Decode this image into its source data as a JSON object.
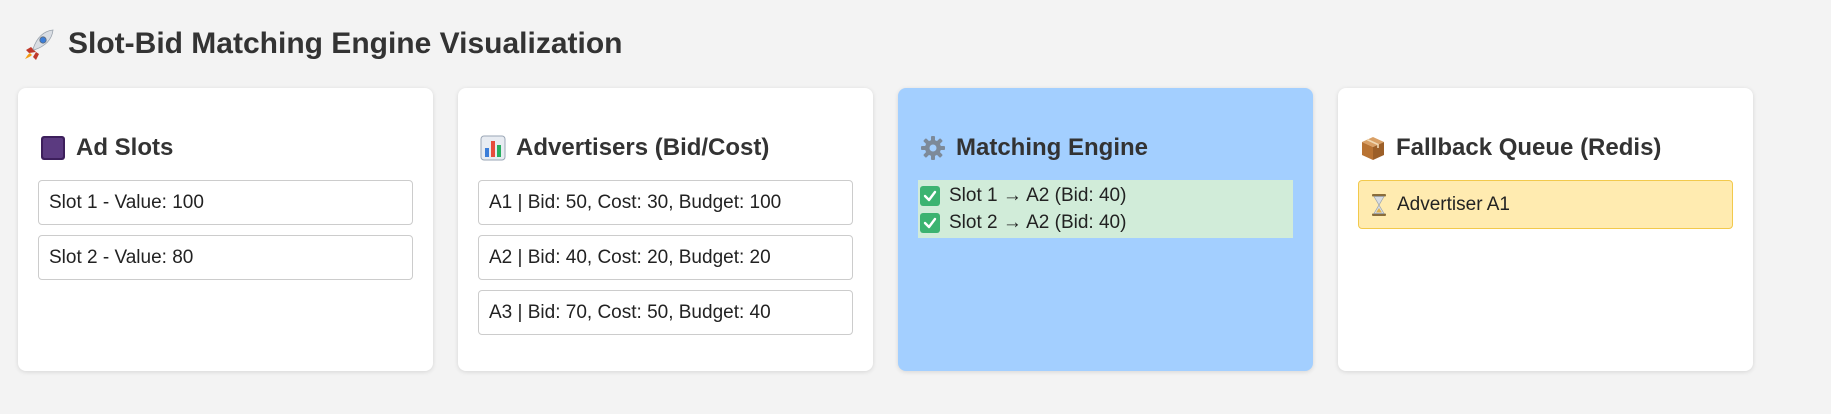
{
  "page": {
    "title": "Slot-Bid Matching Engine Visualization",
    "title_icon": "rocket-icon"
  },
  "ad_slots": {
    "heading": "Ad Slots",
    "icon": "stop-square-icon",
    "items": [
      "Slot 1 - Value: 100",
      "Slot 2 - Value: 80"
    ]
  },
  "advertisers": {
    "heading": "Advertisers (Bid/Cost)",
    "icon": "bar-chart-icon",
    "items": [
      "A1 | Bid: 50, Cost: 30, Budget: 100",
      "A2 | Bid: 40, Cost: 20, Budget: 20",
      "A3 | Bid: 70, Cost: 50, Budget: 40"
    ]
  },
  "matching_engine": {
    "heading": "Matching Engine",
    "icon": "gear-icon",
    "matches": [
      "Slot 1 → A2 (Bid: 40)",
      "Slot 2 → A2 (Bid: 40)"
    ],
    "match_icon": "check-box-icon"
  },
  "fallback_queue": {
    "heading": "Fallback Queue (Redis)",
    "icon": "package-icon",
    "items": [
      "Advertiser A1"
    ],
    "item_icon": "hourglass-icon"
  },
  "colors": {
    "background": "#f3f3f3",
    "panel": "#ffffff",
    "engine_panel": "#a3cfff",
    "match_highlight": "#d1ecd9",
    "queue_item_fill": "#ffebb0",
    "queue_item_border": "#f2c94c",
    "check": "#3cb371"
  }
}
